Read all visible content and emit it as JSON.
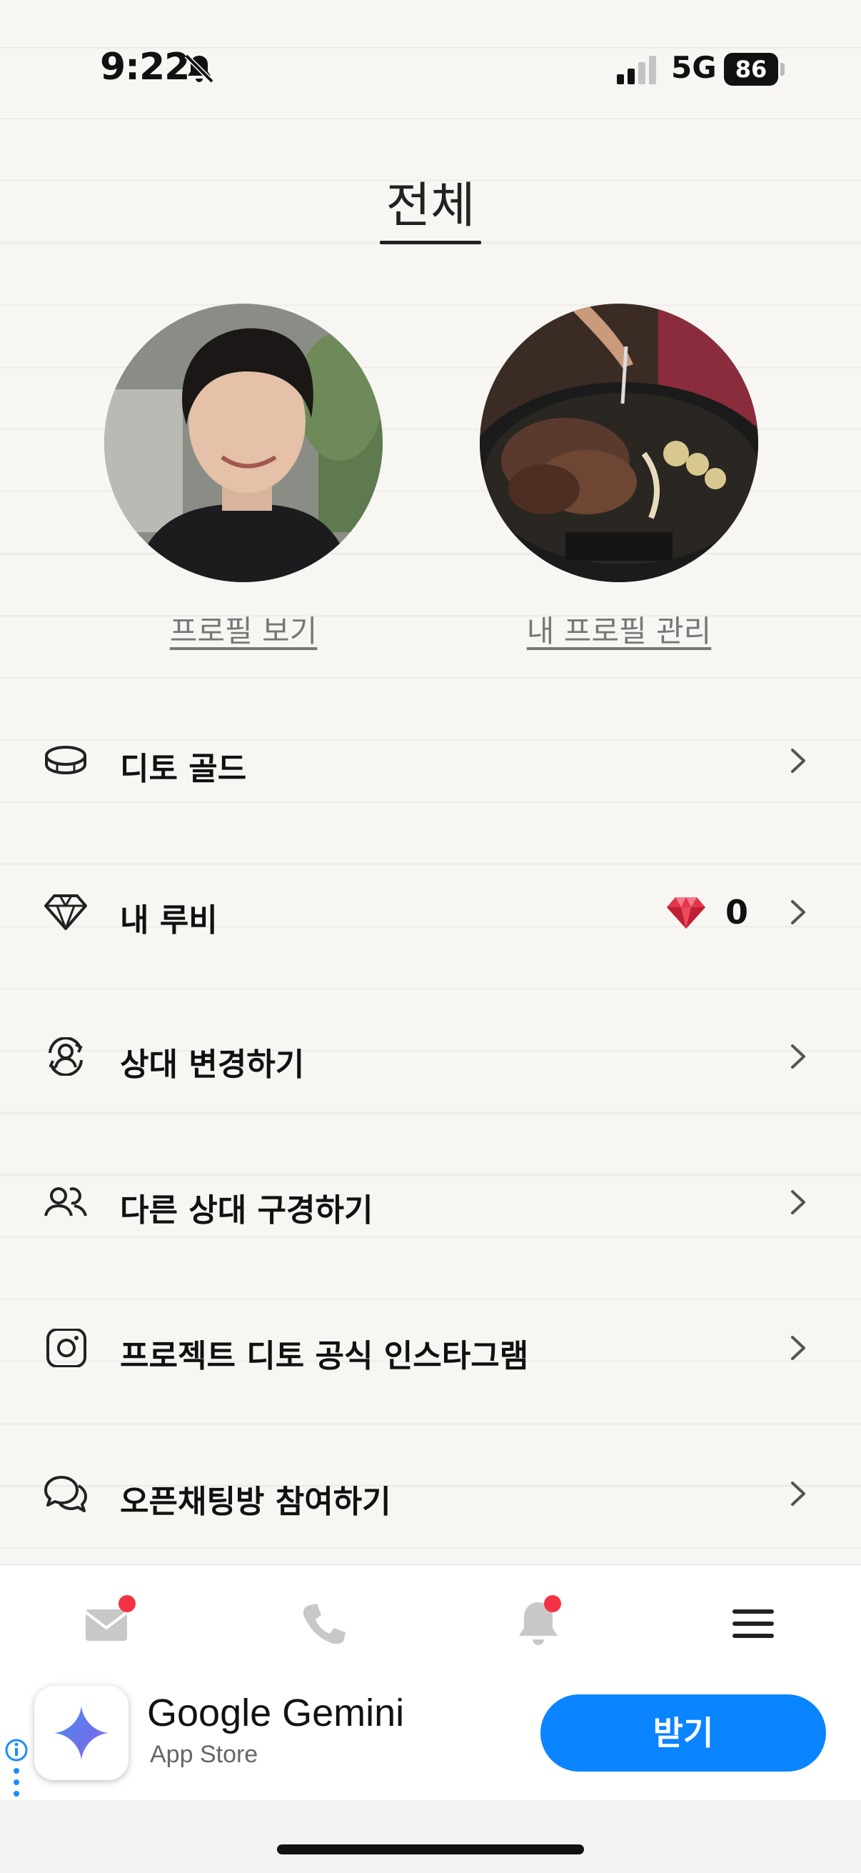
{
  "status_bar": {
    "time": "9:22",
    "network": "5G",
    "battery": "86"
  },
  "page": {
    "title": "전체"
  },
  "profiles": {
    "left_link": "프로필 보기",
    "right_link": "내 프로필 관리"
  },
  "menu": {
    "items": [
      {
        "label": "디토 골드",
        "icon": "coin-icon"
      },
      {
        "label": "내 루비",
        "icon": "diamond-icon",
        "value": "0"
      },
      {
        "label": "상대 변경하기",
        "icon": "switch-user-icon"
      },
      {
        "label": "다른 상대 구경하기",
        "icon": "users-icon"
      },
      {
        "label": "프로젝트 디토 공식 인스타그램",
        "icon": "instagram-icon"
      },
      {
        "label": "오픈채팅방 참여하기",
        "icon": "chat-bubbles-icon"
      }
    ]
  },
  "tab_bar": {
    "tabs": [
      {
        "icon": "mail-icon",
        "badge": true
      },
      {
        "icon": "phone-icon",
        "badge": false
      },
      {
        "icon": "bell-icon",
        "badge": true
      },
      {
        "icon": "menu-icon",
        "badge": false,
        "active": true
      }
    ]
  },
  "ad": {
    "app_name": "Google Gemini",
    "store": "App Store",
    "button_label": "받기"
  },
  "colors": {
    "accent": "#0a84ff",
    "badge": "#f33244",
    "background": "#f7f6f3"
  }
}
